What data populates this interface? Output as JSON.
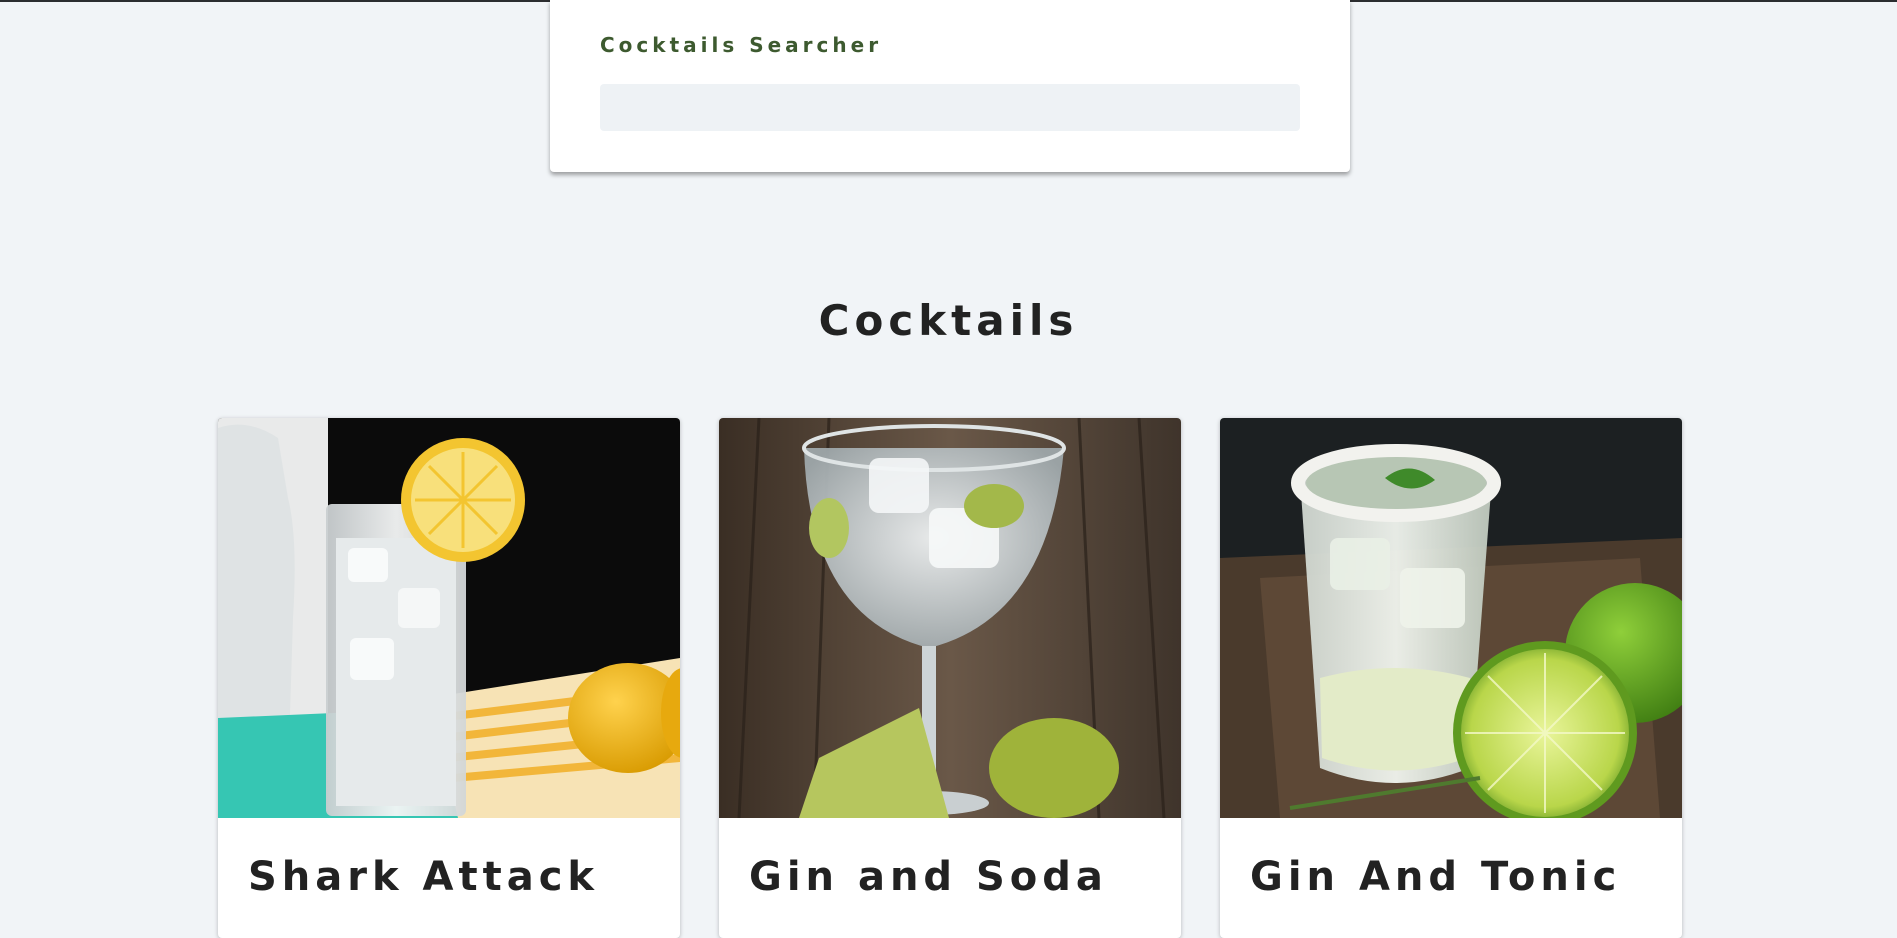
{
  "search": {
    "label": "Cocktails Searcher",
    "value": "",
    "placeholder": ""
  },
  "section": {
    "title": "Cocktails"
  },
  "cocktails": [
    {
      "name": "Shark Attack",
      "image_icon": "lemonade-glass-photo"
    },
    {
      "name": "Gin and Soda",
      "image_icon": "gin-glass-photo"
    },
    {
      "name": "Gin And Tonic",
      "image_icon": "lime-cocktail-photo"
    }
  ],
  "colors": {
    "page_background": "#f1f4f7",
    "search_label": "#3d5a2f",
    "title_text": "#222222",
    "input_background": "#eef2f5"
  }
}
